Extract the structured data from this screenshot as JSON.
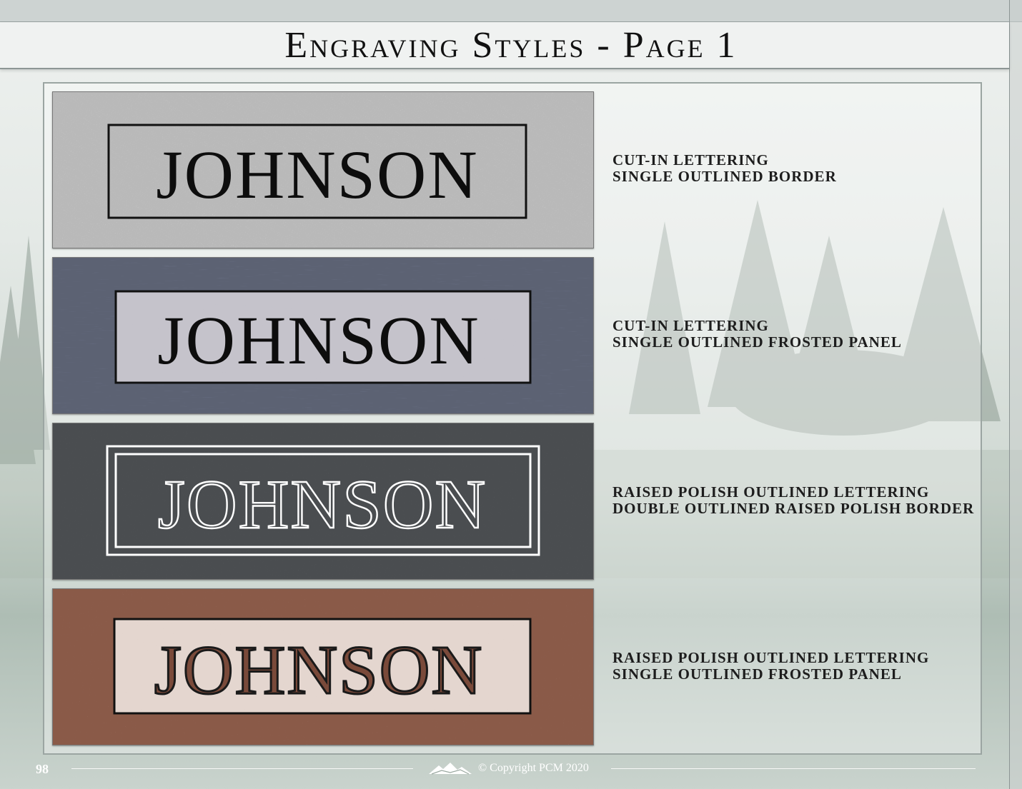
{
  "page": {
    "title": "Engraving Styles - Page 1",
    "page_number": "98",
    "copyright": "© Copyright PCM 2020"
  },
  "styles": [
    {
      "name": "JOHNSON",
      "label_line1": "CUT-IN LETTERING",
      "label_line2": "SINGLE OUTLINED BORDER",
      "granite": "light-gray",
      "colors": {
        "stone": "#b9b9b9",
        "panel": "none",
        "text": "#0d0d0d",
        "border": "#111111"
      }
    },
    {
      "name": "JOHNSON",
      "label_line1": "CUT-IN LETTERING",
      "label_line2": "SINGLE OUTLINED FROSTED PANEL",
      "granite": "blue-gray",
      "colors": {
        "stone": "#5c6273",
        "panel": "#c5c3cb",
        "text": "#0d0d0d",
        "border": "#111111"
      }
    },
    {
      "name": "JOHNSON",
      "label_line1": "RAISED POLISH OUTLINED LETTERING",
      "label_line2": "DOUBLE OUTLINED RAISED POLISH BORDER",
      "granite": "dark-gray",
      "colors": {
        "stone": "#4a4d50",
        "panel": "none",
        "text": "#ffffff",
        "border": "#ffffff"
      }
    },
    {
      "name": "JOHNSON",
      "label_line1": "RAISED POLISH OUTLINED LETTERING",
      "label_line2": "SINGLE OUTLINED FROSTED PANEL",
      "granite": "red-brown",
      "colors": {
        "stone": "#8a5a48",
        "panel": "#e4d6cf",
        "text": "#7a4a3a",
        "border": "#111111"
      }
    }
  ]
}
